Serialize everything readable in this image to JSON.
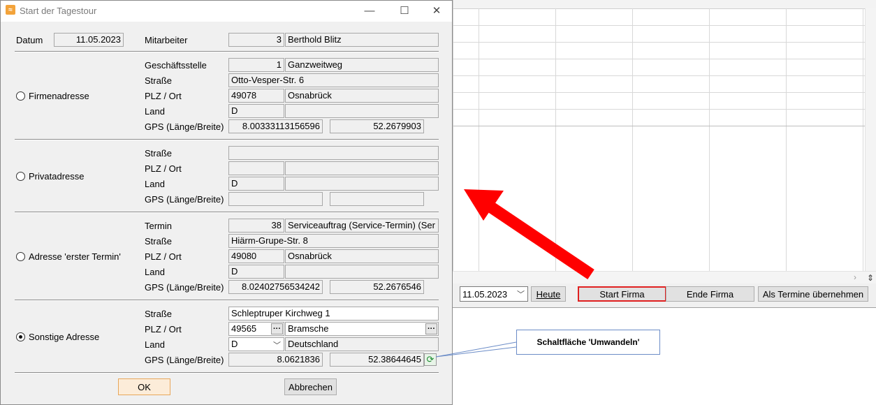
{
  "dialog": {
    "title": "Start der Tagestour",
    "controls": {
      "minimize": "—",
      "maximize": "☐",
      "close": "✕"
    },
    "header": {
      "datum_label": "Datum",
      "datum_value": "11.05.2023",
      "mitarbeiter_label": "Mitarbeiter",
      "mitarbeiter_nr": "3",
      "mitarbeiter_name": "Berthold Blitz"
    },
    "firmenadresse": {
      "radio_label": "Firmenadresse",
      "selected": false,
      "geschaeftsstelle_label": "Geschäftsstelle",
      "geschaeftsstelle_nr": "1",
      "geschaeftsstelle_name": "Ganzweitweg",
      "strasse_label": "Straße",
      "strasse": "Otto-Vesper-Str. 6",
      "plz_ort_label": "PLZ / Ort",
      "plz": "49078",
      "ort": "Osnabrück",
      "land_label": "Land",
      "land_code": "D",
      "land_name": "",
      "gps_label": "GPS (Länge/Breite)",
      "gps_laenge": "8.00333113156596",
      "gps_breite": "52.2679903"
    },
    "privatadresse": {
      "radio_label": "Privatadresse",
      "selected": false,
      "strasse_label": "Straße",
      "strasse": "",
      "plz_ort_label": "PLZ / Ort",
      "plz": "",
      "ort": "",
      "land_label": "Land",
      "land_code": "D",
      "land_name": "",
      "gps_label": "GPS (Länge/Breite)",
      "gps_laenge": "",
      "gps_breite": ""
    },
    "erster_termin": {
      "radio_label": "Adresse 'erster Termin'",
      "selected": false,
      "termin_label": "Termin",
      "termin_nr": "38",
      "termin_name": "Serviceauftrag (Service-Termin) (Ser",
      "strasse_label": "Straße",
      "strasse": "Hiärm-Grupe-Str. 8",
      "plz_ort_label": "PLZ / Ort",
      "plz": "49080",
      "ort": "Osnabrück",
      "land_label": "Land",
      "land_code": "D",
      "land_name": "",
      "gps_label": "GPS (Länge/Breite)",
      "gps_laenge": "8.02402756534242",
      "gps_breite": "52.2676546"
    },
    "sonstige": {
      "radio_label": "Sonstige Adresse",
      "selected": true,
      "strasse_label": "Straße",
      "strasse": "Schleptruper Kirchweg 1",
      "plz_ort_label": "PLZ / Ort",
      "plz": "49565",
      "ort": "Bramsche",
      "land_label": "Land",
      "land_code": "D",
      "land_name": "Deutschland",
      "gps_label": "GPS (Länge/Breite)",
      "gps_laenge": "8.0621836",
      "gps_breite": "52.38644645"
    },
    "ok_label": "OK",
    "cancel_label": "Abbrechen"
  },
  "toolbar": {
    "date_value": "11.05.2023",
    "heute_label": "Heute",
    "start_firma_label": "Start Firma",
    "ende_firma_label": "Ende Firma",
    "termine_label": "Als Termine übernehmen"
  },
  "annotation": {
    "callout_text": "Schaltfläche 'Umwandeln'"
  },
  "colors": {
    "arrow": "#ff0000",
    "highlight": "#e02020",
    "callout_border": "#6b8cc7"
  }
}
